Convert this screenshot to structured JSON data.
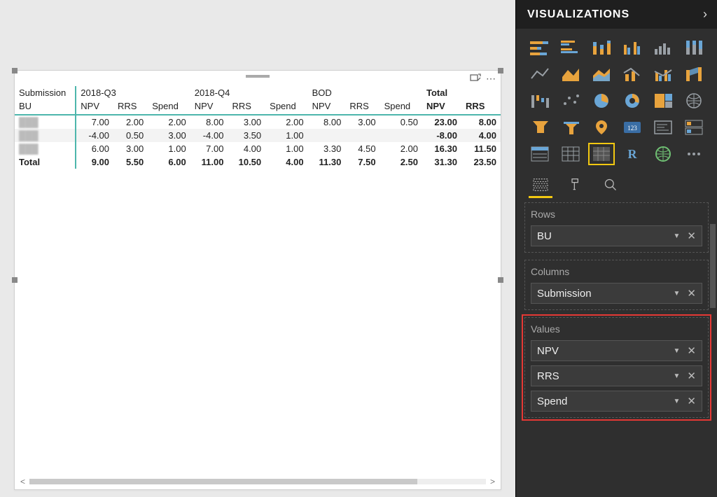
{
  "matrix": {
    "row_field_label": "Submission",
    "row_sub_label": "BU",
    "column_groups": [
      "2018-Q3",
      "2018-Q4",
      "BOD",
      "Total"
    ],
    "measures": [
      "NPV",
      "RRS",
      "Spend"
    ],
    "total_measures_shown": [
      "NPV",
      "RRS"
    ],
    "rows": [
      {
        "label": "",
        "cells": [
          "7.00",
          "2.00",
          "2.00",
          "8.00",
          "3.00",
          "2.00",
          "8.00",
          "3.00",
          "0.50",
          "23.00",
          "8.00"
        ]
      },
      {
        "label": "",
        "cells": [
          "-4.00",
          "0.50",
          "3.00",
          "-4.00",
          "3.50",
          "1.00",
          "",
          "",
          "",
          "-8.00",
          "4.00"
        ]
      },
      {
        "label": "",
        "cells": [
          "6.00",
          "3.00",
          "1.00",
          "7.00",
          "4.00",
          "1.00",
          "3.30",
          "4.50",
          "2.00",
          "16.30",
          "11.50"
        ]
      }
    ],
    "total_label": "Total",
    "total_cells": [
      "9.00",
      "5.50",
      "6.00",
      "11.00",
      "10.50",
      "4.00",
      "11.30",
      "7.50",
      "2.50",
      "31.30",
      "23.50"
    ]
  },
  "panel": {
    "title": "VISUALIZATIONS",
    "tabs": {
      "fields": "Fields",
      "format": "Format",
      "analytics": "Analytics"
    },
    "rows_label": "Rows",
    "columns_label": "Columns",
    "values_label": "Values",
    "rows_items": [
      "BU"
    ],
    "columns_items": [
      "Submission"
    ],
    "values_items": [
      "NPV",
      "RRS",
      "Spend"
    ]
  },
  "viz_tiles": [
    "stacked-bar-icon",
    "clustered-bar-icon",
    "stacked-column-icon",
    "clustered-column-icon",
    "column-series-icon",
    "stacked-column-100-icon",
    "line-icon",
    "area-icon",
    "stacked-area-icon",
    "combo-icon",
    "combo2-icon",
    "ribbon-icon",
    "waterfall-icon",
    "scatter-icon",
    "pie-icon",
    "donut-icon",
    "treemap-icon",
    "map-icon",
    "funnel-icon",
    "gauge-icon",
    "filled-map-icon",
    "kpi-icon",
    "card-icon",
    "multi-row-card-icon",
    "slicer-icon",
    "table-icon",
    "matrix-icon",
    "r-visual-icon",
    "arcgis-icon",
    "more-visuals-icon"
  ],
  "selected_viz": "matrix-icon"
}
